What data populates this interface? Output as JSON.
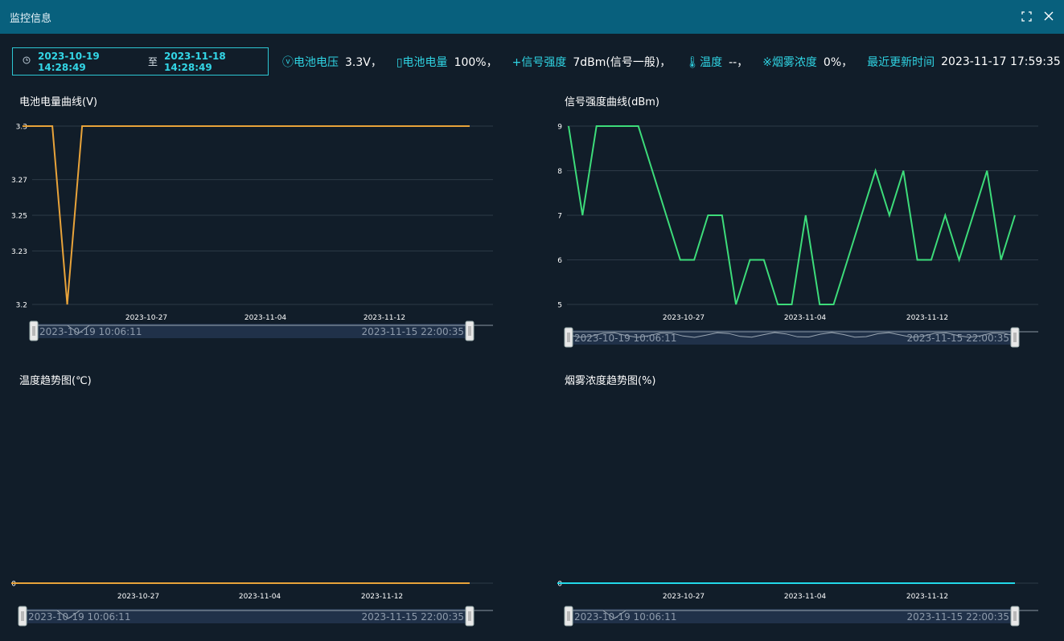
{
  "window": {
    "title": "监控信息",
    "fullscreen_icon": "fullscreen-icon",
    "close_icon": "close-icon"
  },
  "filter": {
    "start": "2023-10-19 14:28:49",
    "to": "至",
    "end": "2023-11-18 14:28:49",
    "icon": "clock-icon"
  },
  "status": {
    "voltage_label": "ⓥ电池电压",
    "voltage_value": "3.3V，",
    "battery_label": "▯电池电量",
    "battery_value": "100%，",
    "signal_label": "+信号强度",
    "signal_value": "7dBm(信号一般)，",
    "temp_label": "🌡温度",
    "temp_value": "--，",
    "smoke_label": "※烟雾浓度",
    "smoke_value": "0%，",
    "updated_label": "最近更新时间",
    "updated_value": "2023-11-17 17:59:35"
  },
  "colors": {
    "voltage": "#e8a33a",
    "signal": "#3ddc7a",
    "temp": "#e8a33a",
    "smoke": "#22d8e8"
  },
  "chart_data": [
    {
      "type": "line",
      "title": "电池电量曲线(V)",
      "y_ticks": [
        "3.3",
        "3.27",
        "3.25",
        "3.23",
        "3.2"
      ],
      "x_ticks": [
        "2023-10-27",
        "2023-11-04",
        "2023-11-12"
      ],
      "ylim": [
        3.2,
        3.3
      ],
      "values": [
        3.3,
        3.3,
        3.3,
        3.2,
        3.3,
        3.3,
        3.3,
        3.3,
        3.3,
        3.3,
        3.3,
        3.3,
        3.3,
        3.3,
        3.3,
        3.3,
        3.3,
        3.3,
        3.3,
        3.3,
        3.3,
        3.3,
        3.3,
        3.3,
        3.3,
        3.3,
        3.3,
        3.3,
        3.3,
        3.3,
        3.3
      ],
      "zoom_start": "2023-10-19 10:06:11",
      "zoom_end": "2023-11-15 22:00:35"
    },
    {
      "type": "line",
      "title": "信号强度曲线(dBm)",
      "y_ticks": [
        "9",
        "8",
        "7",
        "6",
        "5"
      ],
      "x_ticks": [
        "2023-10-27",
        "2023-11-04",
        "2023-11-12"
      ],
      "ylim": [
        5,
        9
      ],
      "values": [
        9,
        7,
        9,
        9,
        9,
        9,
        8,
        7,
        6,
        6,
        7,
        7,
        5,
        6,
        6,
        5,
        5,
        7,
        5,
        5,
        6,
        7,
        8,
        7,
        8,
        6,
        6,
        7,
        6,
        7,
        8,
        6,
        7
      ],
      "zoom_start": "2023-10-19 10:06:11",
      "zoom_end": "2023-11-15 22:00:35"
    },
    {
      "type": "line",
      "title": "温度趋势图(℃)",
      "y_ticks": [
        "0"
      ],
      "x_ticks": [
        "2023-10-27",
        "2023-11-04",
        "2023-11-12"
      ],
      "ylim": [
        0,
        1
      ],
      "values": [
        0,
        0,
        0,
        0,
        0,
        0,
        0,
        0,
        0,
        0,
        0
      ],
      "zoom_start": "2023-10-19 10:06:11",
      "zoom_end": "2023-11-15 22:00:35"
    },
    {
      "type": "line",
      "title": "烟雾浓度趋势图(%)",
      "y_ticks": [
        "0"
      ],
      "x_ticks": [
        "2023-10-27",
        "2023-11-04",
        "2023-11-12"
      ],
      "ylim": [
        0,
        1
      ],
      "values": [
        0,
        0,
        0,
        0,
        0,
        0,
        0,
        0,
        0,
        0,
        0
      ],
      "zoom_start": "2023-10-19 10:06:11",
      "zoom_end": "2023-11-15 22:00:35"
    }
  ]
}
